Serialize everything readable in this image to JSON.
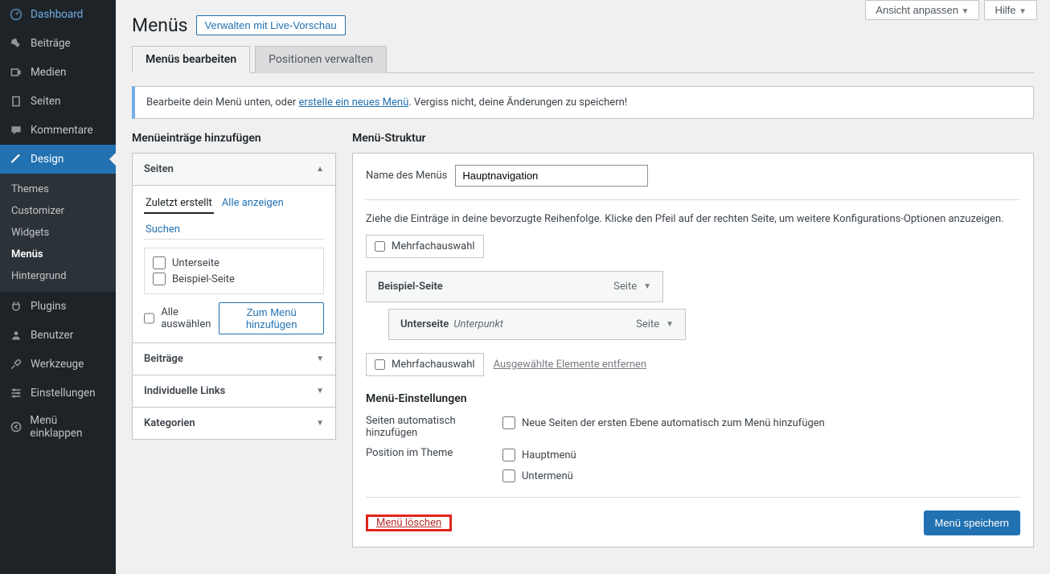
{
  "top": {
    "customize": "Ansicht anpassen",
    "help": "Hilfe"
  },
  "sidebar": {
    "dashboard": "Dashboard",
    "posts": "Beiträge",
    "media": "Medien",
    "pages": "Seiten",
    "comments": "Kommentare",
    "design": "Design",
    "plugins": "Plugins",
    "users": "Benutzer",
    "tools": "Werkzeuge",
    "settings": "Einstellungen",
    "collapse": "Menü einklappen"
  },
  "submenu": {
    "themes": "Themes",
    "customizer": "Customizer",
    "widgets": "Widgets",
    "menus": "Menüs",
    "background": "Hintergrund"
  },
  "header": {
    "title": "Menüs",
    "live_preview": "Verwalten mit Live-Vorschau"
  },
  "tabs": {
    "edit": "Menüs bearbeiten",
    "positions": "Positionen verwalten"
  },
  "notice": {
    "prefix": "Bearbeite dein Menü unten, oder ",
    "link": "erstelle ein neues Menü",
    "suffix": ". Vergiss nicht, deine Änderungen zu speichern!"
  },
  "left": {
    "title": "Menüeinträge hinzufügen",
    "panels": {
      "pages": "Seiten",
      "posts": "Beiträge",
      "links": "Individuelle Links",
      "categories": "Kategorien"
    },
    "subtabs": {
      "recent": "Zuletzt erstellt",
      "all": "Alle anzeigen",
      "search": "Suchen"
    },
    "items": [
      "Unterseite",
      "Beispiel-Seite"
    ],
    "select_all": "Alle auswählen",
    "add_btn": "Zum Menü hinzufügen"
  },
  "right": {
    "title": "Menü-Struktur",
    "name_label": "Name des Menüs",
    "name_value": "Hauptnavigation",
    "help": "Ziehe die Einträge in deine bevorzugte Reihenfolge. Klicke den Pfeil auf der rechten Seite, um weitere Konfigurations-Optionen anzuzeigen.",
    "bulk": "Mehrfachauswahl",
    "remove_selected": "Ausgewählte Elemente entfernen",
    "items": [
      {
        "title": "Beispiel-Seite",
        "type": "Seite",
        "subtitle": ""
      },
      {
        "title": "Unterseite",
        "type": "Seite",
        "subtitle": "Unterpunkt"
      }
    ],
    "settings": {
      "title": "Menü-Einstellungen",
      "auto_label": "Seiten automatisch hinzufügen",
      "auto_opt": "Neue Seiten der ersten Ebene automatisch zum Menü hinzufügen",
      "position_label": "Position im Theme",
      "pos_main": "Hauptmenü",
      "pos_sub": "Untermenü"
    },
    "delete": "Menü löschen",
    "save": "Menü speichern"
  }
}
